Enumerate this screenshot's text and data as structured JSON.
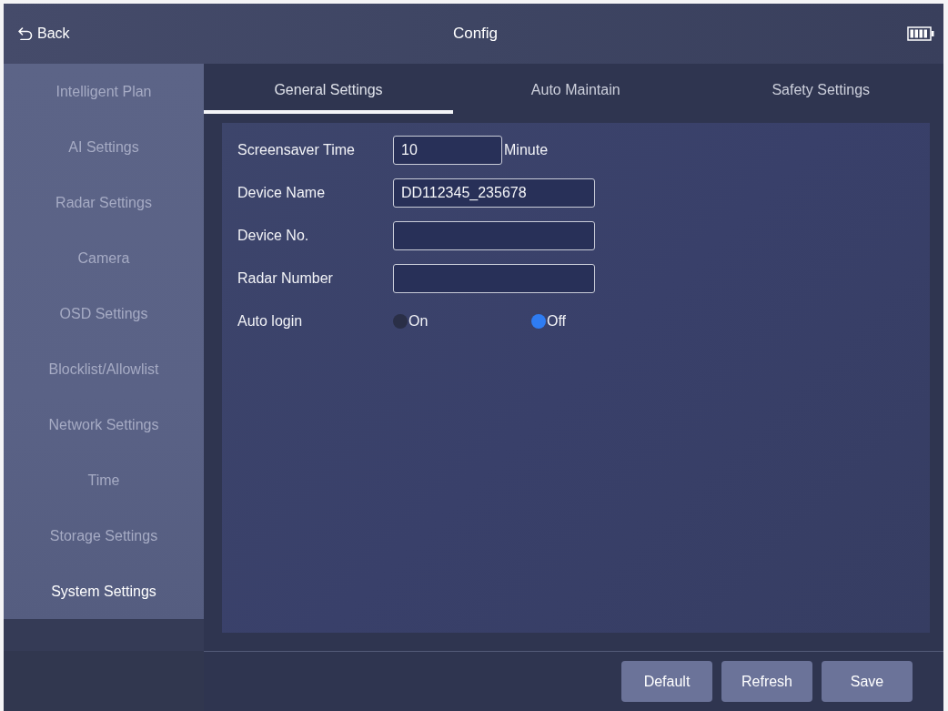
{
  "header": {
    "back": "Back",
    "title": "Config"
  },
  "sidebar": {
    "items": [
      {
        "label": "Intelligent Plan",
        "selected": false
      },
      {
        "label": "AI Settings",
        "selected": false
      },
      {
        "label": "Radar Settings",
        "selected": false
      },
      {
        "label": "Camera",
        "selected": false
      },
      {
        "label": "OSD Settings",
        "selected": false
      },
      {
        "label": "Blocklist/Allowlist",
        "selected": false
      },
      {
        "label": "Network Settings",
        "selected": false
      },
      {
        "label": "Time",
        "selected": false
      },
      {
        "label": "Storage Settings",
        "selected": false
      },
      {
        "label": "System Settings",
        "selected": true
      }
    ]
  },
  "tabs": [
    {
      "label": "General Settings",
      "selected": true
    },
    {
      "label": "Auto Maintain",
      "selected": false
    },
    {
      "label": "Safety Settings",
      "selected": false
    }
  ],
  "form": {
    "rows": [
      {
        "kind": "text",
        "label": "Screensaver Time",
        "value": "10",
        "unit": "Minute"
      },
      {
        "kind": "text",
        "label": "Device Name",
        "value": "DD112345_235678"
      },
      {
        "kind": "text",
        "label": "Device No."
      },
      {
        "kind": "text",
        "label": "Radar Number"
      },
      {
        "kind": "radio",
        "label": "Auto login",
        "options": [
          {
            "label": "On",
            "selected": false
          },
          {
            "label": "Off",
            "selected": true
          }
        ]
      }
    ]
  },
  "buttons": [
    "Default",
    "Refresh",
    "Save"
  ]
}
